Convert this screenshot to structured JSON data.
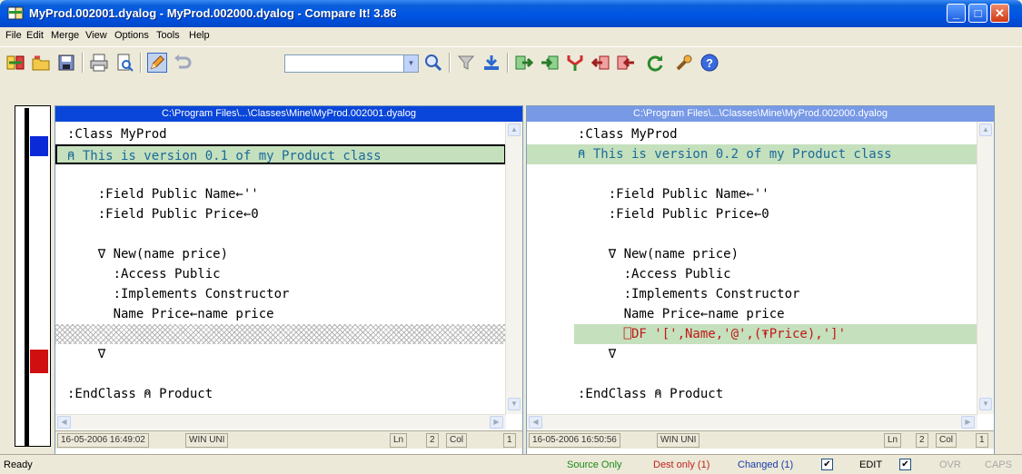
{
  "window": {
    "title": "MyProd.002001.dyalog - MyProd.002000.dyalog - Compare It! 3.86",
    "min": "_",
    "max": "□",
    "close": "✕"
  },
  "menu": [
    "File",
    "Edit",
    "Merge",
    "View",
    "Options",
    "Tools",
    "Help"
  ],
  "toolbar": {
    "search_value": "",
    "combo_arrow": "▼"
  },
  "left": {
    "header": "C:\\Program Files\\...\\Classes\\Mine\\MyProd.002001.dyalog",
    "lines": [
      ":Class MyProd",
      "⍝ This is version 0.1 of my Product class",
      "",
      "    :Field Public Name←''",
      "    :Field Public Price←0",
      "",
      "    ∇ New(name price)",
      "      :Access Public",
      "      :Implements Constructor",
      "      Name Price←name price",
      "",
      "    ∇",
      "",
      ":EndClass ⍝ Product"
    ],
    "status": {
      "datetime": "16-05-2006 16:49:02",
      "encoding": "WIN UNI",
      "ln_label": "Ln",
      "ln": "2",
      "col_label": "Col",
      "col": "1"
    }
  },
  "right": {
    "header": "C:\\Program Files\\...\\Classes\\Mine\\MyProd.002000.dyalog",
    "lines": [
      ":Class MyProd",
      "⍝ This is version 0.2 of my Product class",
      "",
      "    :Field Public Name←''",
      "    :Field Public Price←0",
      "",
      "    ∇ New(name price)",
      "      :Access Public",
      "      :Implements Constructor",
      "      Name Price←name price",
      "      ⎕DF '[',Name,'@',(⍕Price),']'",
      "    ∇",
      "",
      ":EndClass ⍝ Product"
    ],
    "status": {
      "datetime": "16-05-2006 16:50:56",
      "encoding": "WIN UNI",
      "ln_label": "Ln",
      "ln": "2",
      "col_label": "Col",
      "col": "1"
    }
  },
  "diff_markers": {
    "open": "▷",
    "close": "◁"
  },
  "statusbar": {
    "ready": "Ready",
    "source_only": "Source Only",
    "dest_only": "Dest only (1)",
    "changed": "Changed (1)",
    "check": "✔",
    "edit": "EDIT",
    "ovr": "OVR",
    "caps": "CAPS"
  },
  "colors": {
    "changed_line": "#c5e0bd",
    "apl_red": "#c01818",
    "active_header": "#0a46d9",
    "inactive_header": "#7799e6"
  }
}
